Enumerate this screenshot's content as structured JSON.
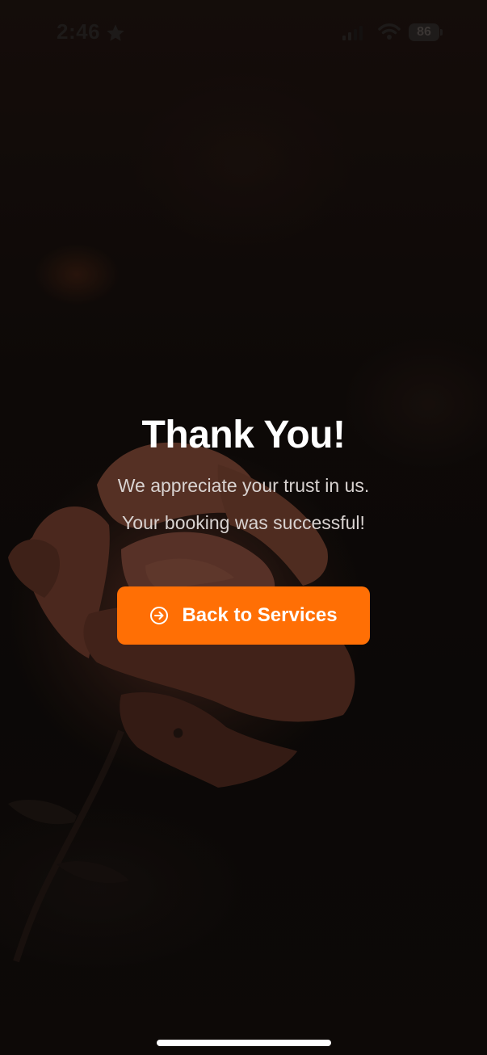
{
  "status_bar": {
    "time": "2:46",
    "battery": "86",
    "icons": [
      "star-icon",
      "signal-icon",
      "wifi-icon",
      "battery-icon"
    ]
  },
  "thank_you": {
    "title": "Thank You!",
    "message_line_1": "We appreciate your trust in us.",
    "message_line_2": "Your booking was successful!"
  },
  "button": {
    "label": "Back to Services",
    "icon": "circle-arrow-right-icon"
  },
  "colors": {
    "accent": "#ff6f05",
    "background": "#0d0908",
    "title_text": "#ffffff",
    "body_text": "#d9d3d1"
  }
}
